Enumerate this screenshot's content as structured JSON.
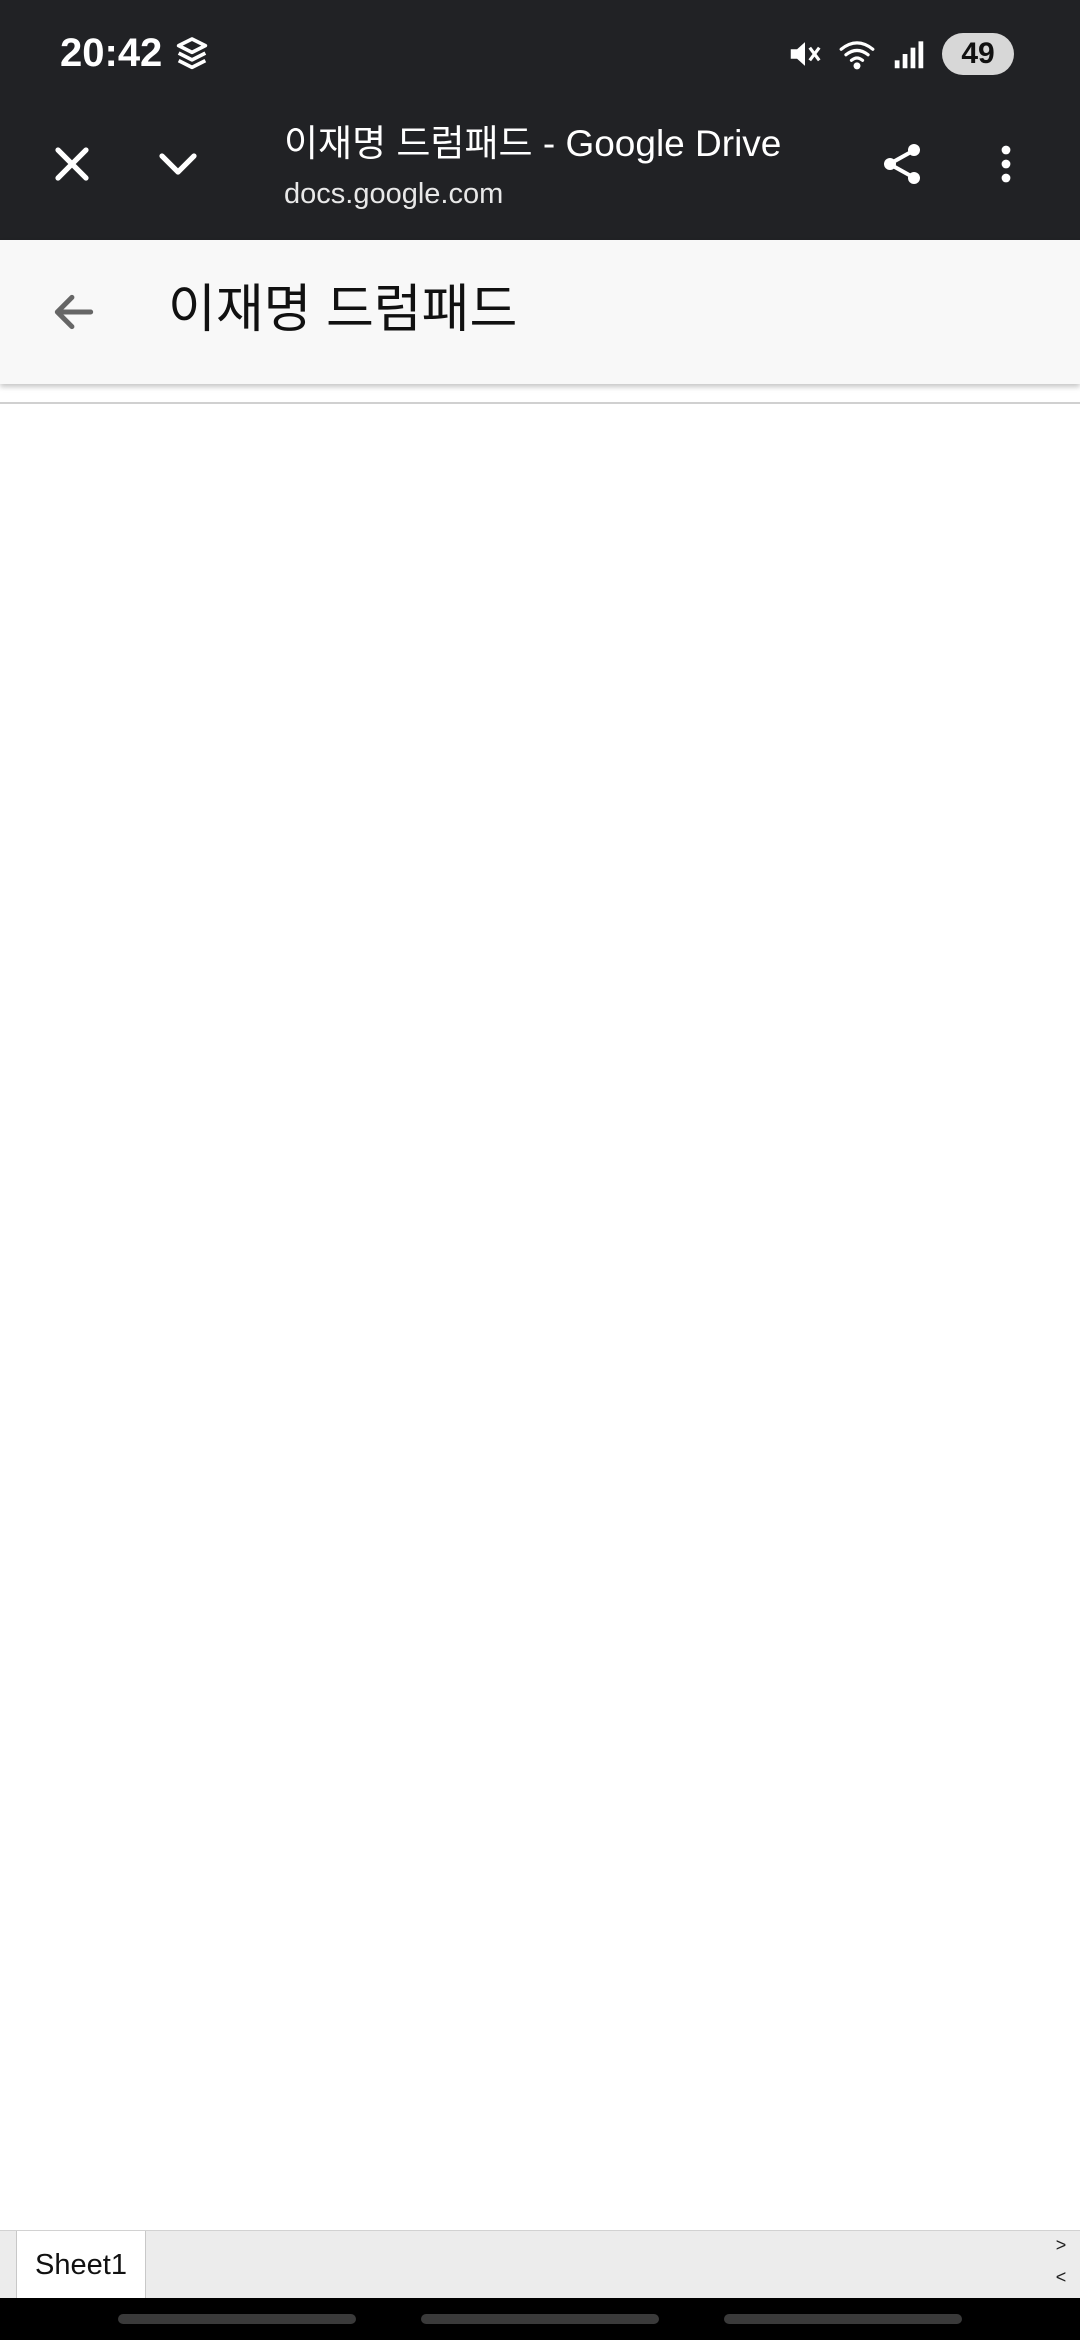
{
  "status_bar": {
    "time": "20:42",
    "left_icon": "layers-icon",
    "right_icons": [
      "mute-icon",
      "wifi-icon",
      "signal-icon"
    ],
    "battery": "49"
  },
  "browser_toolbar": {
    "title": "이재명 드럼패드 - Google Drive",
    "url": "docs.google.com",
    "buttons": [
      "close-icon",
      "chevron-down-icon",
      "share-icon",
      "more-vert-icon"
    ]
  },
  "app_bar": {
    "title": "이재명 드럼패드"
  },
  "sheet_tabs": {
    "tabs": [
      "Sheet1"
    ],
    "scroll_right": ">",
    "scroll_left": "<"
  },
  "colors": {
    "toolbar_bg": "#212225",
    "app_bar_bg": "#f8f8f8",
    "sheet_bar_bg": "#ececec"
  }
}
